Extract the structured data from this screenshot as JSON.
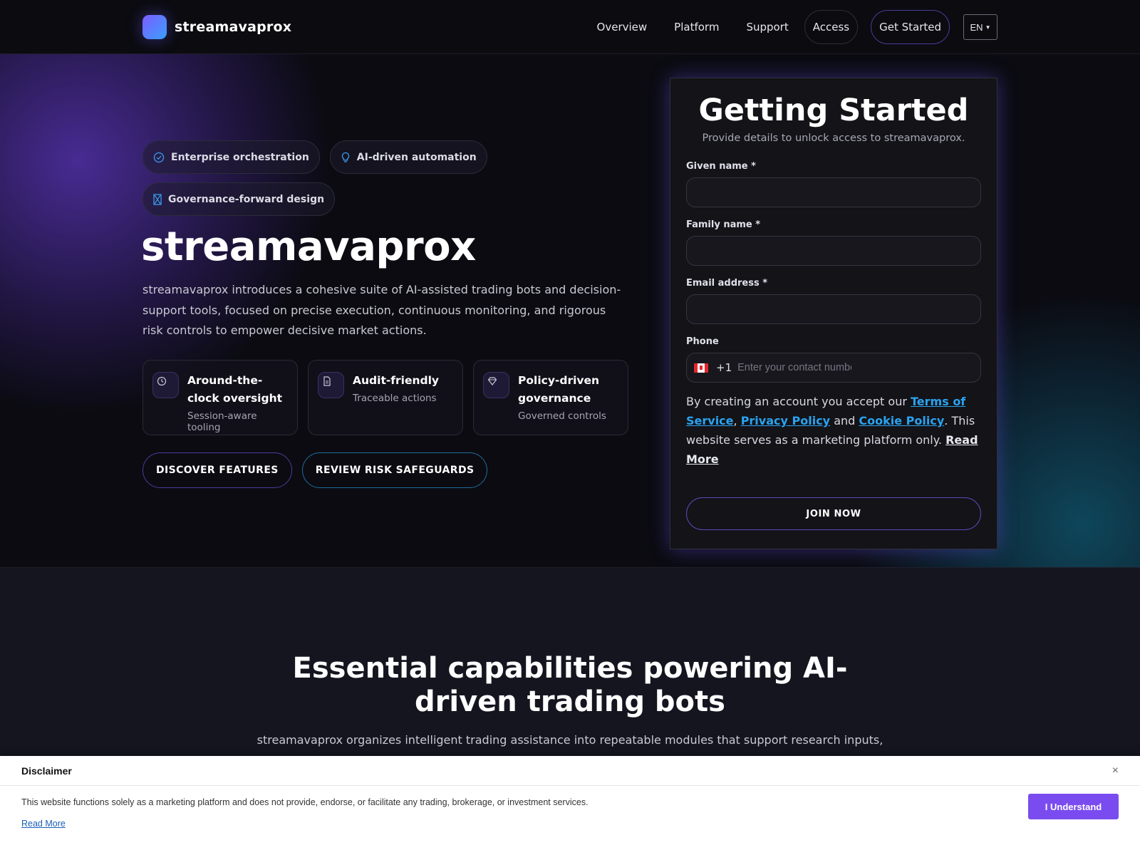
{
  "header": {
    "brand": "streamavaprox",
    "nav": [
      "Overview",
      "Platform",
      "Support"
    ],
    "access_label": "Access",
    "get_started_label": "Get Started",
    "language": "EN"
  },
  "hero": {
    "badges": [
      "Enterprise orchestration",
      "AI-driven automation",
      "Governance-forward design"
    ],
    "title": "streamavaprox",
    "description": "streamavaprox introduces a cohesive suite of AI-assisted trading bots and decision-support tools, focused on precise execution, continuous monitoring, and rigorous risk controls to empower decisive market actions.",
    "features": [
      {
        "title": "Around-the-clock oversight",
        "subtitle": "Session-aware tooling"
      },
      {
        "title": "Audit-friendly",
        "subtitle": "Traceable actions"
      },
      {
        "title": "Policy-driven governance",
        "subtitle": "Governed controls"
      }
    ],
    "cta_primary": "DISCOVER FEATURES",
    "cta_secondary": "REVIEW RISK SAFEGUARDS"
  },
  "form": {
    "title": "Getting Started",
    "subtitle": "Provide details to unlock access to streamavaprox.",
    "given_name_label": "Given name *",
    "family_name_label": "Family name *",
    "email_label": "Email address *",
    "phone_label": "Phone",
    "phone_dial_code": "+1",
    "phone_placeholder": "Enter your contact number",
    "terms_prefix": "By creating an account you accept our",
    "terms_link": "Terms of Service",
    "privacy_link": "Privacy Policy",
    "and_text": "and",
    "cookie_link": "Cookie Policy",
    "terms_suffix": ". This website serves as a marketing platform only.",
    "read_more": "Read More",
    "submit_label": "JOIN NOW"
  },
  "capabilities": {
    "title": "Essential capabilities powering AI-driven trading bots",
    "description": "streamavaprox organizes intelligent trading assistance into repeatable modules that support research inputs,"
  },
  "disclaimer": {
    "title": "Disclaimer",
    "close_icon": "×",
    "text": "This website functions solely as a marketing platform and does not provide, endorse, or facilitate any trading, brokerage, or investment services.",
    "read_more": "Read More",
    "button_label": "I Understand"
  },
  "colors": {
    "accent": "#7a4cf0",
    "link": "#2aa3f0",
    "background": "#0c0c12"
  }
}
